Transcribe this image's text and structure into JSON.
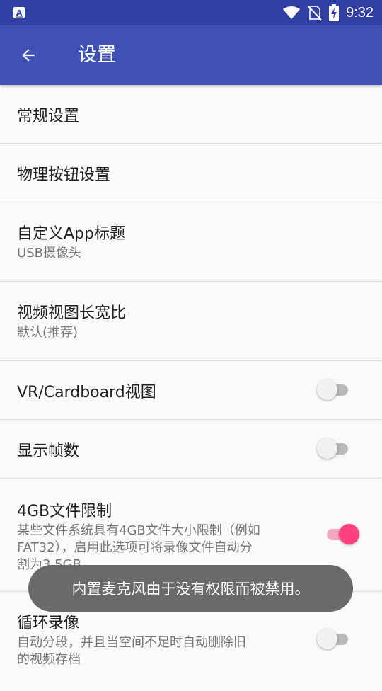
{
  "status_bar": {
    "time": "9:32",
    "icons": [
      "app-a-icon",
      "wifi-icon",
      "no-sim-icon",
      "battery-charging-icon"
    ]
  },
  "app_bar": {
    "title": "设置",
    "background": "#3f51b5"
  },
  "settings": [
    {
      "title": "常规设置"
    },
    {
      "title": "物理按钮设置"
    },
    {
      "title": "自定义App标题",
      "summary": "USB摄像头"
    },
    {
      "title": "视频视图长宽比",
      "summary": "默认(推荐)"
    },
    {
      "title": "VR/Cardboard视图",
      "switch": false
    },
    {
      "title": "显示帧数",
      "switch": false
    },
    {
      "title": "4GB文件限制",
      "summary_lines": [
        "某些文件系统具有4GB文件大小限制（例如",
        "FAT32），启用此选项可将录像文件自动分",
        "割为3.5GB"
      ],
      "switch": true
    },
    {
      "title": "循环录像",
      "summary_lines": [
        "自动分段，并且当空间不足时自动删除旧",
        "的视频存档"
      ],
      "switch": false
    }
  ],
  "toast": {
    "message": "内置麦克风由于没有权限而被禁用。"
  },
  "colors": {
    "primary": "#3f51b5",
    "primary_dark": "#2f3fa3",
    "accent": "#ff4081"
  }
}
